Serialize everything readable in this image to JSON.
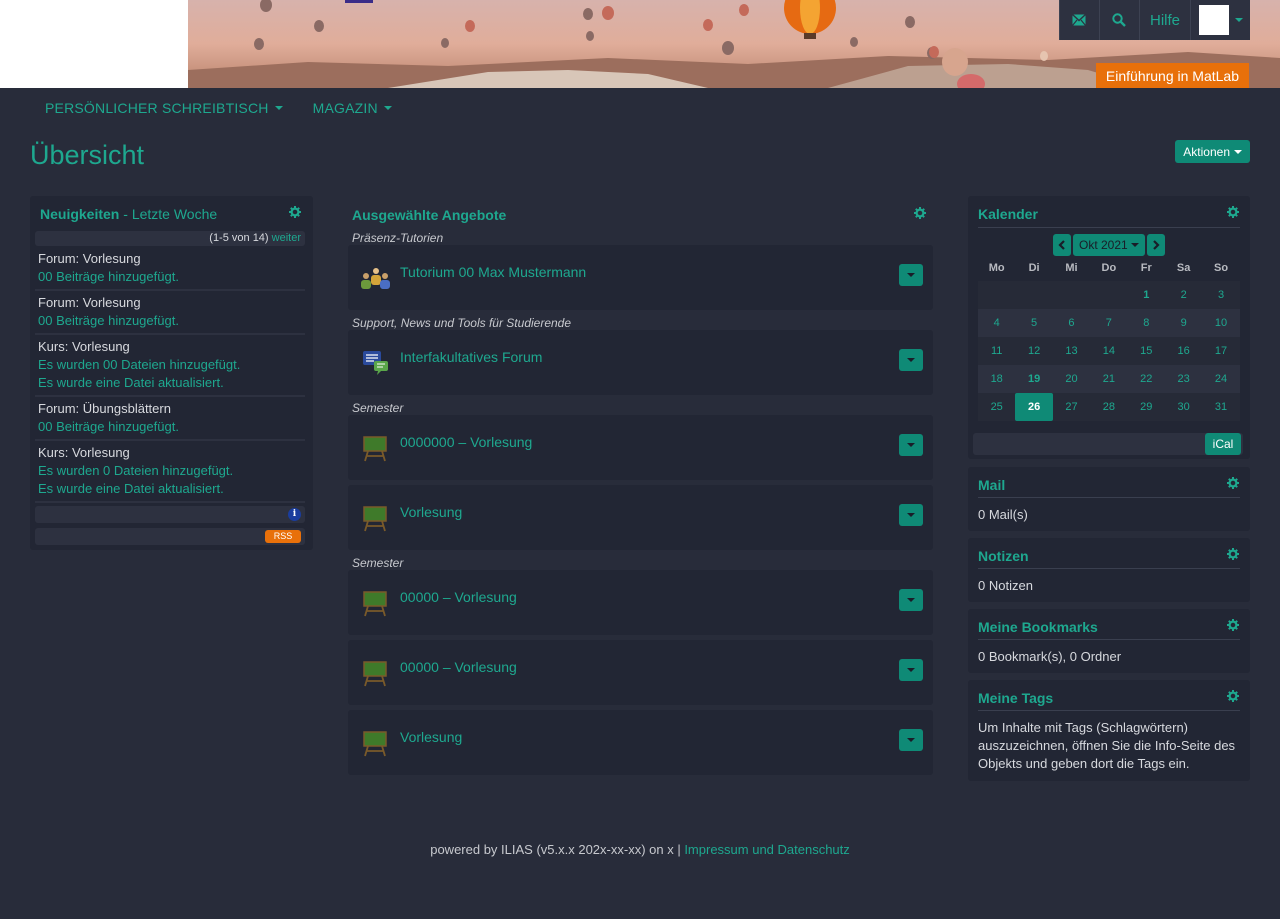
{
  "header": {
    "help_label": "Hilfe",
    "course_badge": "Einführung in MatLab",
    "icons": [
      "mail-icon",
      "search-icon"
    ]
  },
  "nav": {
    "items": [
      {
        "label": "PERSÖNLICHER SCHREIBTISCH"
      },
      {
        "label": "MAGAZIN"
      }
    ]
  },
  "page": {
    "title": "Übersicht",
    "actions_label": "Aktionen"
  },
  "news": {
    "title": "Neuigkeiten",
    "title_sep": " - ",
    "subtitle": "Letzte Woche",
    "pager": "(1-5 von 14)",
    "more": "weiter",
    "items": [
      {
        "title": "Forum: Vorlesung",
        "lines": [
          "00 Beiträge hinzugefügt."
        ]
      },
      {
        "title": "Forum: Vorlesung",
        "lines": [
          "00 Beiträge hinzugefügt."
        ]
      },
      {
        "title": "Kurs: Vorlesung",
        "lines": [
          "Es wurden 00 Dateien hinzugefügt.",
          "Es wurde eine Datei aktualisiert."
        ]
      },
      {
        "title": "Forum: Übungsblättern",
        "lines": [
          "00 Beiträge hinzugefügt."
        ]
      },
      {
        "title": "Kurs: Vorlesung",
        "lines": [
          "Es wurden 0 Dateien hinzugefügt.",
          "Es wurde eine Datei aktualisiert."
        ]
      }
    ],
    "info_icon": "i",
    "rss_label": "RSS"
  },
  "offers": {
    "title": "Ausgewählte Angebote",
    "sections": [
      {
        "label": "Präsenz-Tutorien",
        "items": [
          {
            "title": "Tutorium 00 Max Mustermann",
            "icon": "group-icon"
          }
        ]
      },
      {
        "label": "Support, News und Tools für Studierende",
        "items": [
          {
            "title": "Interfakultatives Forum",
            "icon": "forum-icon"
          }
        ]
      },
      {
        "label": "Semester",
        "items": [
          {
            "title": "0000000 – Vorlesung",
            "icon": "course-icon"
          },
          {
            "title": "Vorlesung",
            "icon": "course-icon"
          }
        ]
      },
      {
        "label": "Semester",
        "items": [
          {
            "title": "00000 – Vorlesung",
            "icon": "course-icon"
          },
          {
            "title": "00000 – Vorlesung",
            "icon": "course-icon"
          },
          {
            "title": "Vorlesung",
            "icon": "course-icon"
          }
        ]
      }
    ]
  },
  "calendar": {
    "title": "Kalender",
    "month": "Okt 2021",
    "weekdays": [
      "Mo",
      "Di",
      "Mi",
      "Do",
      "Fr",
      "Sa",
      "So"
    ],
    "weeks": [
      [
        "",
        "",
        "",
        "",
        "1",
        "2",
        "3"
      ],
      [
        "4",
        "5",
        "6",
        "7",
        "8",
        "9",
        "10"
      ],
      [
        "11",
        "12",
        "13",
        "14",
        "15",
        "16",
        "17"
      ],
      [
        "18",
        "19",
        "20",
        "21",
        "22",
        "23",
        "24"
      ],
      [
        "25",
        "26",
        "27",
        "28",
        "29",
        "30",
        "31"
      ]
    ],
    "bold_day": "1",
    "highlight_day": "19",
    "today": "26",
    "ical_label": "iCal"
  },
  "mail": {
    "title": "Mail",
    "text": "0 Mail(s)"
  },
  "notes": {
    "title": "Notizen",
    "text": "0 Notizen"
  },
  "bookmarks": {
    "title": "Meine Bookmarks",
    "text": "0 Bookmark(s), 0 Ordner"
  },
  "tags": {
    "title": "Meine Tags",
    "text": "Um Inhalte mit Tags (Schlagwörtern) auszuzeichnen, öffnen Sie die Info-Seite des Objekts und geben dort die Tags ein."
  },
  "footer": {
    "text": "powered by ILIAS (v5.x.x 202x-xx-xx) on x | ",
    "link": "Impressum und Datenschutz"
  }
}
